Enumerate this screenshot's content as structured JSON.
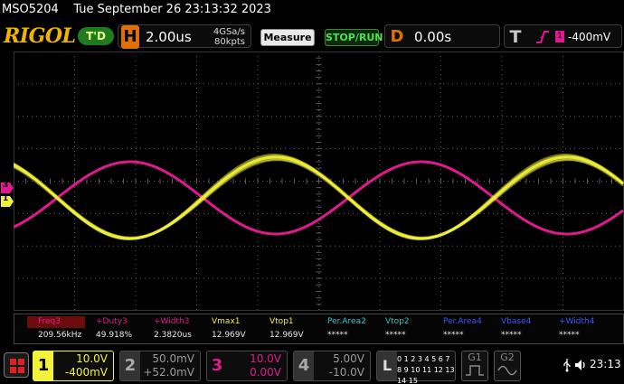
{
  "status": {
    "model": "MSO5204",
    "datetime": "Tue September 26 23:13:32 2023"
  },
  "header": {
    "brand": "RIGOL",
    "trigger_status": "T'D",
    "horizontal": {
      "letter": "H",
      "timebase": "2.00us",
      "sample_rate": "4GSa/s",
      "memory_depth": "80kpts"
    },
    "buttons": {
      "measure": "Measure",
      "stop_run": "STOP/RUN"
    },
    "delay": {
      "letter": "D",
      "value": "0.00s"
    },
    "trigger": {
      "letter": "T",
      "source": "1",
      "level": "-400mV"
    }
  },
  "screen": {
    "channel1_marker": "1",
    "channel3_marker": "3",
    "trigger_position_marker": "T"
  },
  "measurements": [
    {
      "label": "Freq3",
      "value": "209.56kHz",
      "color": "#e0198f",
      "highlight": true
    },
    {
      "label": "+Duty3",
      "value": "49.918%",
      "color": "#e0198f"
    },
    {
      "label": "+Width3",
      "value": "2.3820us",
      "color": "#e0198f"
    },
    {
      "label": "Vmax1",
      "value": "12.969V",
      "color": "#f2f23a"
    },
    {
      "label": "Vtop1",
      "value": "12.969V",
      "color": "#f2f23a"
    },
    {
      "label": "Per.Area2",
      "value": "*****",
      "color": "#2ec4c4"
    },
    {
      "label": "Vtop2",
      "value": "*****",
      "color": "#2ec4c4"
    },
    {
      "label": "Per.Area4",
      "value": "*****",
      "color": "#3a55ff"
    },
    {
      "label": "Vbase4",
      "value": "*****",
      "color": "#3a55ff"
    },
    {
      "label": "+Width4",
      "value": "*****",
      "color": "#3a55ff"
    }
  ],
  "channels": [
    {
      "number": "1",
      "scale": "10.0V",
      "offset": "-400mV",
      "color": "#f2f23a",
      "active": true
    },
    {
      "number": "2",
      "scale": "50.0mV",
      "offset": "+52.0mV",
      "color": "#9a9a9a",
      "active": false
    },
    {
      "number": "3",
      "scale": "10.0V",
      "offset": "0.00V",
      "color": "#e0198f",
      "active": true
    },
    {
      "number": "4",
      "scale": "5.00V",
      "offset": "-10.0V",
      "color": "#9a9a9a",
      "active": false
    }
  ],
  "logic": {
    "letter": "L",
    "row1": "0 1 2 3 4 5 6 7",
    "row2": "8 9 10 11 12 13 14 15"
  },
  "generators": [
    {
      "label": "G1"
    },
    {
      "label": "G2"
    }
  ],
  "system": {
    "time": "23:13",
    "usb_icon": "usb-icon",
    "speaker_icon": "speaker-icon"
  },
  "colors": {
    "ch1": "#f2f23a",
    "ch3": "#e0198f",
    "grid": "#5a5a5a",
    "brand": "#f0b400"
  }
}
